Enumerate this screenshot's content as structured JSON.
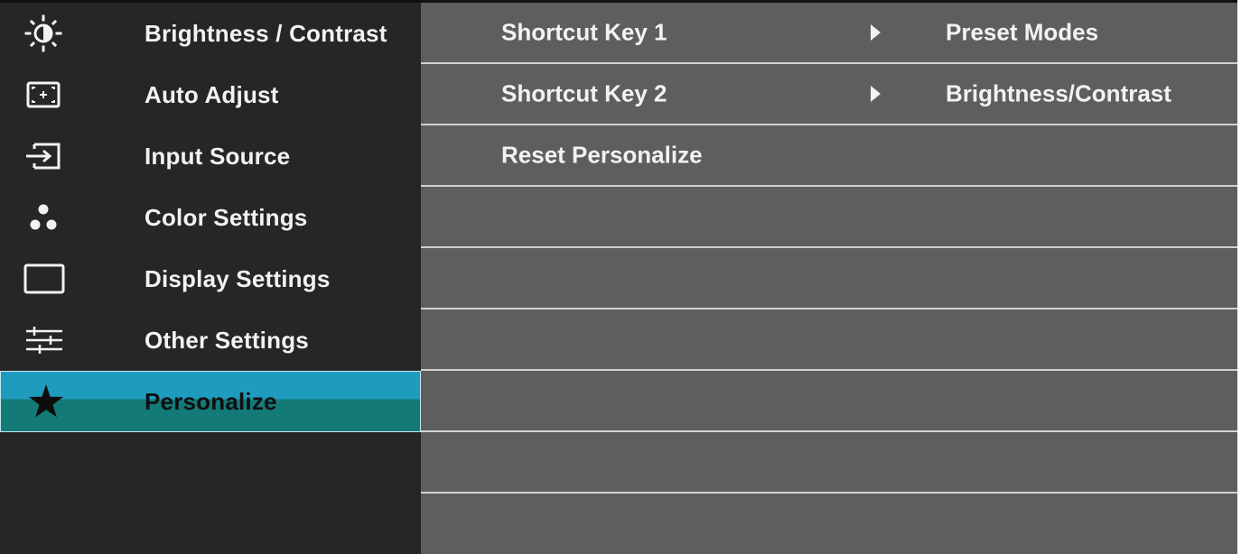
{
  "menu": {
    "items": [
      {
        "label": "Brightness / Contrast",
        "icon": "brightness-icon"
      },
      {
        "label": "Auto Adjust",
        "icon": "auto-adjust-icon"
      },
      {
        "label": "Input Source",
        "icon": "input-source-icon"
      },
      {
        "label": "Color Settings",
        "icon": "color-settings-icon"
      },
      {
        "label": "Display Settings",
        "icon": "display-settings-icon"
      },
      {
        "label": "Other Settings",
        "icon": "other-settings-icon"
      },
      {
        "label": "Personalize",
        "icon": "star-icon",
        "selected": true
      }
    ]
  },
  "panel": {
    "rows": [
      {
        "label": "Shortcut Key 1",
        "value": "Preset Modes"
      },
      {
        "label": "Shortcut Key 2",
        "value": "Brightness/Contrast"
      },
      {
        "label": "Reset Personalize",
        "value": ""
      }
    ]
  },
  "colors": {
    "menu_bg": "#252626",
    "panel_bg": "#5e5e5e",
    "selected_top": "#1f9bbd",
    "selected_bottom": "#137a78",
    "divider": "#d2d2d2",
    "text": "#f2f2f2"
  }
}
